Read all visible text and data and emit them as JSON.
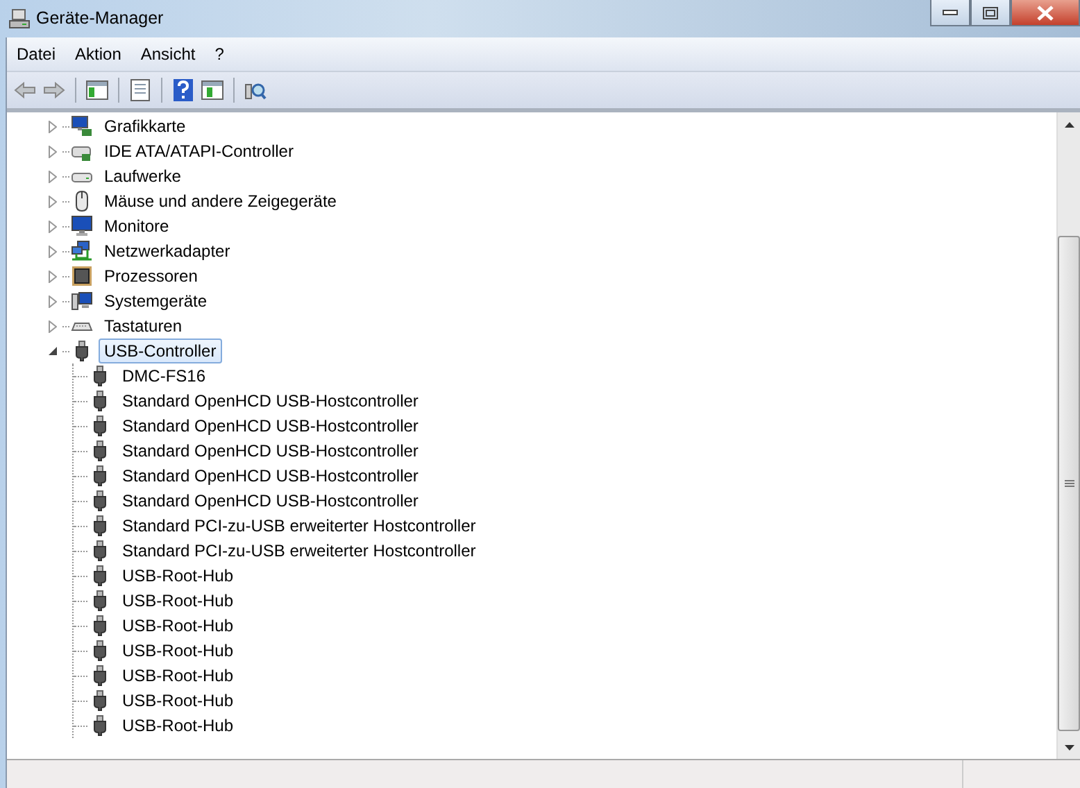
{
  "window": {
    "title": "Geräte-Manager"
  },
  "menu": [
    "Datei",
    "Aktion",
    "Ansicht",
    "?"
  ],
  "tree": [
    {
      "label": "Grafikkarte",
      "kind": "display",
      "expanded": false,
      "selected": false
    },
    {
      "label": "IDE ATA/ATAPI-Controller",
      "kind": "disk",
      "expanded": false,
      "selected": false
    },
    {
      "label": "Laufwerke",
      "kind": "drive",
      "expanded": false,
      "selected": false
    },
    {
      "label": "Mäuse und andere Zeigegeräte",
      "kind": "mouse",
      "expanded": false,
      "selected": false
    },
    {
      "label": "Monitore",
      "kind": "monitor",
      "expanded": false,
      "selected": false
    },
    {
      "label": "Netzwerkadapter",
      "kind": "network",
      "expanded": false,
      "selected": false
    },
    {
      "label": "Prozessoren",
      "kind": "cpu",
      "expanded": false,
      "selected": false
    },
    {
      "label": "Systemgeräte",
      "kind": "system",
      "expanded": false,
      "selected": false
    },
    {
      "label": "Tastaturen",
      "kind": "keyboard",
      "expanded": false,
      "selected": false
    },
    {
      "label": "USB-Controller",
      "kind": "usb",
      "expanded": true,
      "selected": true,
      "children": [
        {
          "label": "DMC-FS16",
          "kind": "usb",
          "selected": false
        },
        {
          "label": "Standard OpenHCD USB-Hostcontroller",
          "kind": "usb",
          "selected": false
        },
        {
          "label": "Standard OpenHCD USB-Hostcontroller",
          "kind": "usb",
          "selected": false
        },
        {
          "label": "Standard OpenHCD USB-Hostcontroller",
          "kind": "usb",
          "selected": false
        },
        {
          "label": "Standard OpenHCD USB-Hostcontroller",
          "kind": "usb",
          "selected": false
        },
        {
          "label": "Standard OpenHCD USB-Hostcontroller",
          "kind": "usb",
          "selected": false
        },
        {
          "label": "Standard PCI-zu-USB erweiterter Hostcontroller",
          "kind": "usb",
          "selected": false
        },
        {
          "label": "Standard PCI-zu-USB erweiterter Hostcontroller",
          "kind": "usb",
          "selected": false
        },
        {
          "label": "USB-Root-Hub",
          "kind": "usb",
          "selected": false
        },
        {
          "label": "USB-Root-Hub",
          "kind": "usb",
          "selected": false
        },
        {
          "label": "USB-Root-Hub",
          "kind": "usb",
          "selected": false
        },
        {
          "label": "USB-Root-Hub",
          "kind": "usb",
          "selected": false
        },
        {
          "label": "USB-Root-Hub",
          "kind": "usb",
          "selected": false
        },
        {
          "label": "USB-Root-Hub",
          "kind": "usb",
          "selected": false
        },
        {
          "label": "USB-Root-Hub",
          "kind": "usb",
          "selected": false
        }
      ]
    }
  ]
}
